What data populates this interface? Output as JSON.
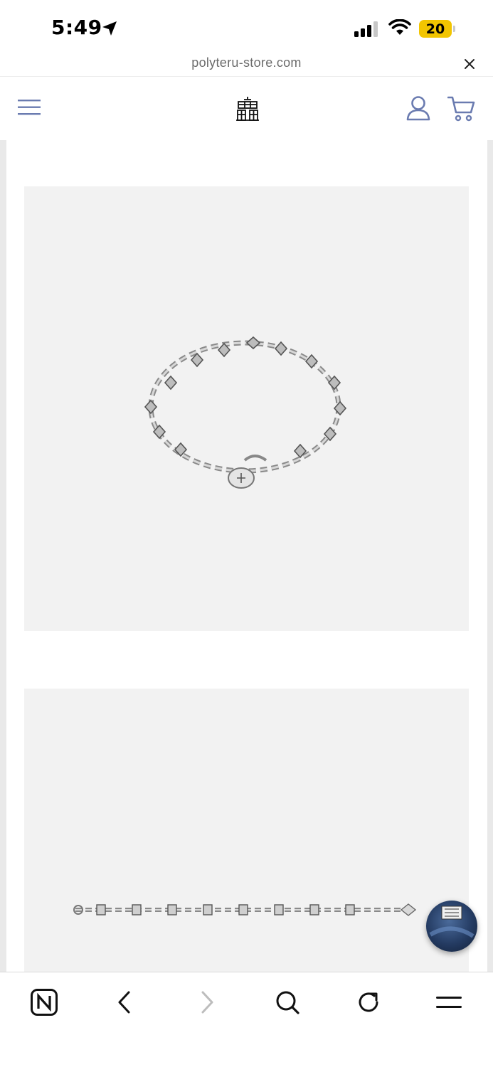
{
  "status_bar": {
    "time": "5:49",
    "battery": "20",
    "icons": [
      "location-arrow-icon",
      "signal-icon",
      "wifi-icon",
      "battery-icon"
    ]
  },
  "url_bar": {
    "url": "polyteru-store.com",
    "close_icon": "close-icon"
  },
  "header": {
    "menu_icon": "hamburger-menu-icon",
    "logo_icon": "store-logo-icon",
    "account_icon": "account-icon",
    "cart_icon": "cart-icon"
  },
  "content": {
    "images": [
      "product-image-bracelet-loop",
      "product-image-bracelet-flat"
    ],
    "chat_button": "chat-widget"
  },
  "toolbar": {
    "icons": [
      "naver-home-icon",
      "back-icon",
      "forward-icon",
      "search-icon",
      "reload-icon",
      "menu-icon"
    ]
  },
  "colors": {
    "accent": "#6a7bb0",
    "image_bg": "#f2f2f2",
    "battery": "#f2c500"
  }
}
